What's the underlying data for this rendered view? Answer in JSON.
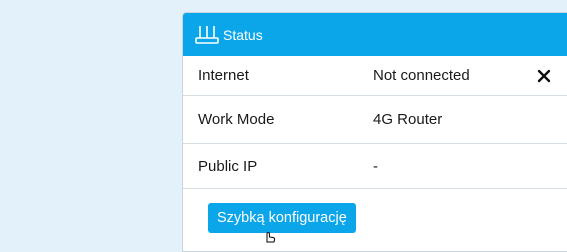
{
  "status_panel": {
    "title": "Status",
    "header_icon": "router-icon",
    "rows": [
      {
        "label": "Internet",
        "value": "Not connected",
        "status_icon": "close-icon"
      },
      {
        "label": "Work Mode",
        "value": "4G Router"
      },
      {
        "label": "Public IP",
        "value": "-"
      }
    ],
    "quick_setup_label": "Szybką konfigurację"
  },
  "colors": {
    "accent": "#0aa6e9",
    "page_background": "#e3f2fa"
  }
}
